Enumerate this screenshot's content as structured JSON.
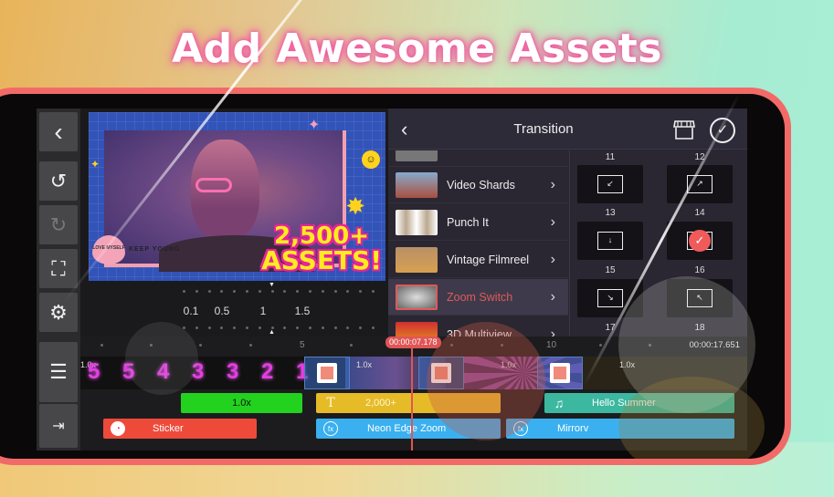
{
  "headline": "Add Awesome Assets",
  "toolbar": {
    "items": [
      {
        "name": "back",
        "icon": "chevron-left-icon",
        "glyph": "‹"
      },
      {
        "name": "undo",
        "icon": "undo-icon",
        "glyph": "↺"
      },
      {
        "name": "redo",
        "icon": "redo-icon",
        "glyph": "↻"
      },
      {
        "name": "crop",
        "icon": "crop-frame-icon",
        "glyph": "⛶"
      },
      {
        "name": "settings",
        "icon": "gear-icon",
        "glyph": "⚙"
      },
      {
        "name": "layers",
        "icon": "expand-tracks-icon",
        "glyph": "☰"
      },
      {
        "name": "export",
        "icon": "export-icon",
        "glyph": "⇥"
      }
    ]
  },
  "preview": {
    "badge_line1": "2,500+",
    "badge_line2": "ASSETS!",
    "heart_text": "LOVE MYSELF",
    "sticker_text": "KEEP YOUNG",
    "smiley": "☺"
  },
  "speed_ruler": {
    "labels": [
      "0.1",
      "0.5",
      "1",
      "1.5"
    ]
  },
  "transition_panel": {
    "title": "Transition",
    "back_icon": "‹",
    "confirm_icon": "✓",
    "categories": [
      {
        "label": "Video Shards",
        "thumb": "#a85040",
        "selected": false
      },
      {
        "label": "Punch It",
        "thumb": "#d8d4d0",
        "selected": false
      },
      {
        "label": "Vintage Filmreel",
        "thumb": "#c89860",
        "selected": false
      },
      {
        "label": "Zoom Switch",
        "thumb": "#888888",
        "selected": true
      },
      {
        "label": "3D Multiview",
        "thumb": "#d03030",
        "selected": false
      }
    ],
    "chevron": "›",
    "presets": [
      {
        "num": "11",
        "glyph": "↙",
        "selected": false
      },
      {
        "num": "12",
        "glyph": "↗",
        "selected": false
      },
      {
        "num": "13",
        "glyph": "↓",
        "selected": false
      },
      {
        "num": "14",
        "glyph": "✓",
        "selected": true
      },
      {
        "num": "15",
        "glyph": "↘",
        "selected": false
      },
      {
        "num": "16",
        "glyph": "↖",
        "selected": false
      },
      {
        "num": "17",
        "glyph": "",
        "selected": false
      },
      {
        "num": "18",
        "glyph": "",
        "selected": false
      }
    ]
  },
  "timeline": {
    "ruler_labels": [
      "5",
      "10"
    ],
    "current_time": "00:00:07.178",
    "end_time": "00:00:17.651",
    "countdown": [
      "5",
      "5",
      "4",
      "3",
      "3",
      "2",
      "1"
    ],
    "clip_speeds": [
      "1.0x",
      "1.0x",
      "1.0x",
      "1.0x"
    ],
    "layers": {
      "green": {
        "label": "1.0x",
        "color": "#22d21e"
      },
      "text": {
        "label": "2,000+",
        "icon": "T",
        "color": "#e6bb28"
      },
      "audio": {
        "label": "Hello Summer",
        "icon": "♫",
        "color": "#3cb8a0"
      },
      "sticker": {
        "label": "Sticker",
        "color": "#ee4a3a"
      },
      "fx1": {
        "label": "Neon Edge Zoom",
        "icon": "fx",
        "color": "#3ab0f0"
      },
      "fx2": {
        "label": "Mirrorv",
        "icon": "fx",
        "color": "#3ab0f0"
      }
    }
  },
  "colors": {
    "accent_red": "#e05555",
    "frame": "#f26a68",
    "headline_glow": "#f05aa0"
  }
}
